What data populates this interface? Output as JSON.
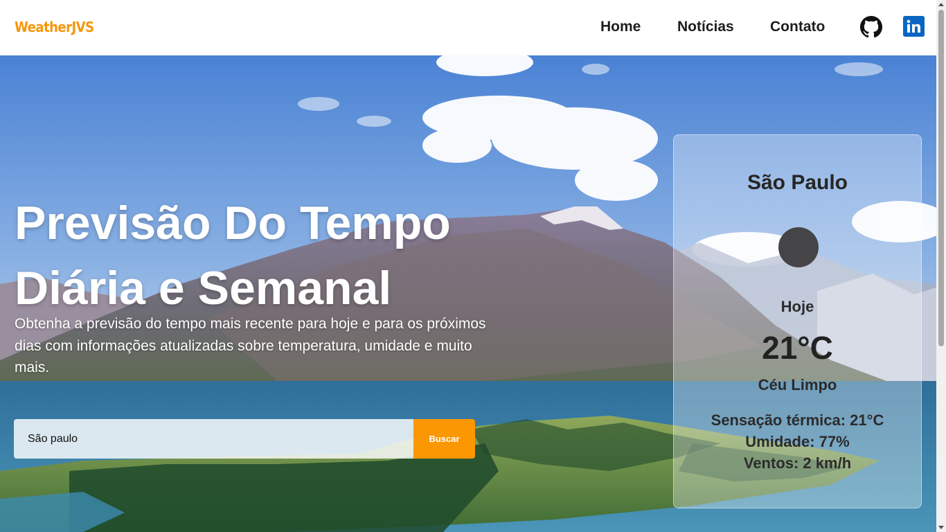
{
  "brand": {
    "name": "WeatherJVS",
    "accent": "#f5960a"
  },
  "nav": {
    "items": [
      {
        "label": "Home"
      },
      {
        "label": "Notícias"
      },
      {
        "label": "Contato"
      }
    ],
    "icons": [
      "github-icon",
      "linkedin-icon"
    ]
  },
  "hero": {
    "title_line1": "Previsão Do Tempo",
    "title_line2": "Diária e Semanal",
    "subtitle": "Obtenha a previsão do tempo mais recente para hoje e para os próximos dias com informações atualizadas sobre temperatura, umidade e muito mais."
  },
  "search": {
    "value": "São paulo",
    "button_label": "Buscar",
    "button_color": "#fb9700"
  },
  "weather": {
    "city": "São Paulo",
    "icon": "weather-icon",
    "day": "Hoje",
    "temperature": "21°C",
    "condition": "Céu Limpo",
    "feels_like": "Sensação térmica: 21°C",
    "humidity": "Umidade: 77%",
    "wind": "Ventos: 2 km/h"
  }
}
